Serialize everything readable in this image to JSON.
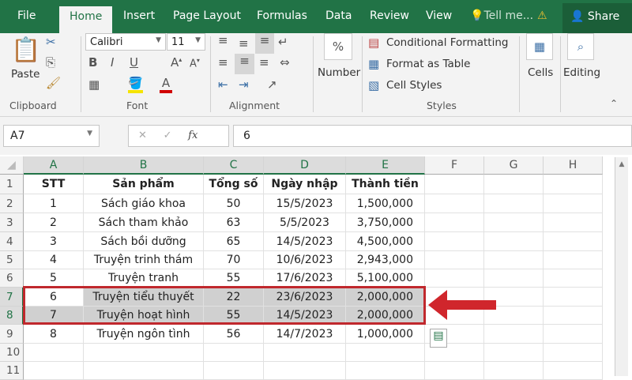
{
  "tabs": [
    "File",
    "Home",
    "Insert",
    "Page Layout",
    "Formulas",
    "Data",
    "Review",
    "View"
  ],
  "tell_me": "Tell me...",
  "share": "Share",
  "ribbon": {
    "clipboard": {
      "paste": "Paste",
      "label": "Clipboard"
    },
    "font": {
      "name": "Calibri",
      "size": "11",
      "bold": "B",
      "italic": "I",
      "underline": "U",
      "label": "Font"
    },
    "alignment": {
      "label": "Alignment"
    },
    "number": {
      "symbol": "%",
      "label": "Number"
    },
    "styles": {
      "conditional": "Conditional Formatting",
      "format_table": "Format as Table",
      "cell_styles": "Cell Styles",
      "label": "Styles"
    },
    "cells": {
      "label": "Cells"
    },
    "editing": {
      "label": "Editing"
    }
  },
  "formula_bar": {
    "name_box": "A7",
    "fx": "fx",
    "value": "6"
  },
  "columns": [
    "A",
    "B",
    "C",
    "D",
    "E",
    "F",
    "G",
    "H"
  ],
  "rows": [
    "1",
    "2",
    "3",
    "4",
    "5",
    "6",
    "7",
    "8",
    "9",
    "10",
    "11"
  ],
  "table": {
    "headers": [
      "STT",
      "Sản phẩm",
      "Tổng số",
      "Ngày nhập",
      "Thành tiền"
    ],
    "data": [
      [
        "1",
        "Sách giáo khoa",
        "50",
        "15/5/2023",
        "1,500,000"
      ],
      [
        "2",
        "Sách tham khảo",
        "63",
        "5/5/2023",
        "3,750,000"
      ],
      [
        "3",
        "Sách bồi dưỡng",
        "65",
        "14/5/2023",
        "4,500,000"
      ],
      [
        "4",
        "Truyện trinh thám",
        "70",
        "10/6/2023",
        "2,943,000"
      ],
      [
        "5",
        "Truyện tranh",
        "55",
        "17/6/2023",
        "5,100,000"
      ],
      [
        "6",
        "Truyện tiểu thuyết",
        "22",
        "23/6/2023",
        "2,000,000"
      ],
      [
        "7",
        "Truyện hoạt hình",
        "55",
        "14/5/2023",
        "2,000,000"
      ],
      [
        "8",
        "Truyện ngôn tình",
        "56",
        "14/7/2023",
        "1,000,000"
      ]
    ]
  },
  "selected_rows": [
    "7",
    "8"
  ],
  "colors": {
    "excel_green": "#217346",
    "highlight": "#c00000"
  }
}
